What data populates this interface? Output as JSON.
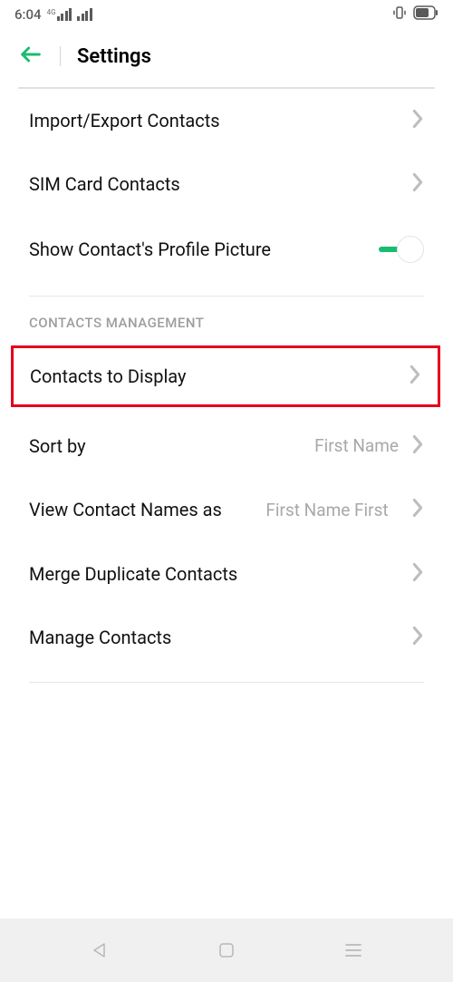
{
  "status": {
    "time": "6:04",
    "network_label": "4G"
  },
  "header": {
    "title": "Settings"
  },
  "rows": {
    "import_export": "Import/Export Contacts",
    "sim_card": "SIM Card Contacts",
    "profile_picture": "Show Contact's Profile Picture",
    "contacts_to_display": "Contacts to Display",
    "sort_by": {
      "label": "Sort by",
      "value": "First Name"
    },
    "view_names": {
      "label": "View Contact Names as",
      "value": "First Name First"
    },
    "merge_duplicates": "Merge Duplicate Contacts",
    "manage_contacts": "Manage Contacts"
  },
  "sections": {
    "contacts_management": "CONTACTS MANAGEMENT"
  },
  "toggles": {
    "profile_picture_on": true
  }
}
